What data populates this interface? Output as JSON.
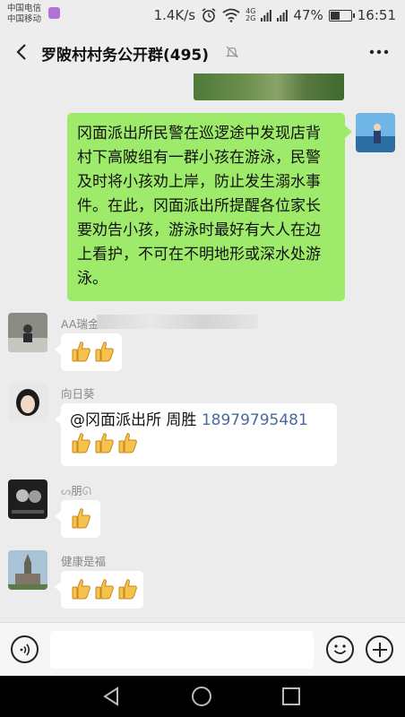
{
  "status_bar": {
    "carrier1": "中国电信",
    "carrier2": "中国移动",
    "net_speed": "1.4K/s",
    "battery": "47%",
    "battery_level": 0.47,
    "time": "16:51",
    "net_4g": "4G",
    "net_2g": "2G"
  },
  "header": {
    "title": "罗陂村村务公开群(495)"
  },
  "messages": {
    "notice": "冈面派出所民警在巡逻途中发现店背村下高陂组有一群小孩在游泳，民警及时将小孩劝上岸，防止发生溺水事件。在此，冈面派出所提醒各位家长要劝告小孩，游泳时最好有大人在边上看护，不可在不明地形或深水处游泳。",
    "sender1": "AA瑞金",
    "sender2": "向日葵",
    "mention_at": "@冈面派出所 周胜",
    "mention_phone": "18979795481",
    "sender3": "朋",
    "sender4": "健康是福"
  },
  "colors": {
    "sent_bubble": "#9eea6a",
    "received_bubble": "#ffffff",
    "chat_bg": "#ececec",
    "phone_link": "#4a6a9c"
  }
}
